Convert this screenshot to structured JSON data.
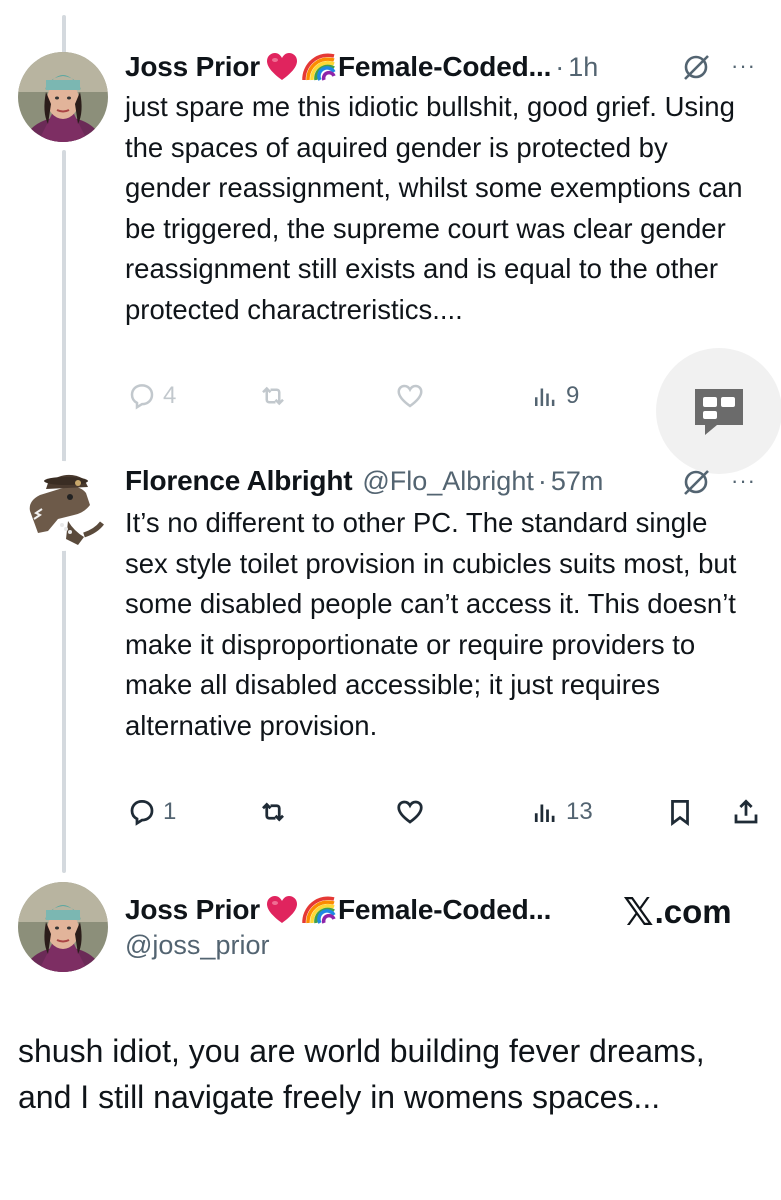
{
  "tweets": [
    {
      "name": "Joss Prior",
      "display_suffix": "Female-Coded...",
      "dot": "·",
      "time": "1h",
      "more": "···",
      "text": "just spare me this idiotic bullshit, good grief. Using the spaces of aquired gender is protected by gender reassignment, whilst some exemptions can be triggered, the supreme court was clear gender reassignment still exists and is equal to the other protected charactreristics....",
      "reply_count": "4",
      "views": "9"
    },
    {
      "name": "Florence Albright",
      "handle": "@Flo_Albright",
      "dot": "·",
      "time": "57m",
      "more": "···",
      "text": "It’s no different to other PC. The standard single sex style toilet provision in cubicles suits most, but some disabled people can’t access it. This doesn’t make it disproportionate or require providers to make all disabled accessible; it just requires alternative provision.",
      "reply_count": "1",
      "views": "13"
    }
  ],
  "card": {
    "name": "Joss Prior",
    "display_suffix": "Female-Coded...",
    "handle": "@joss_prior",
    "brand_x": "𝕏",
    "brand_domain": ".com",
    "text": "shush idiot, you are world building fever dreams, and I still navigate freely in womens spaces..."
  },
  "colors": {
    "text": "#0f1419",
    "secondary": "#536471",
    "thread_line": "#d4d9de",
    "heart": "#e0245e"
  },
  "icons": [
    "reply-icon",
    "repost-icon",
    "like-icon",
    "views-icon",
    "bookmark-icon",
    "share-icon",
    "grok-icon",
    "more-icon",
    "heart-emoji-icon",
    "rainbow-emoji-icon",
    "quote-card-icon"
  ]
}
